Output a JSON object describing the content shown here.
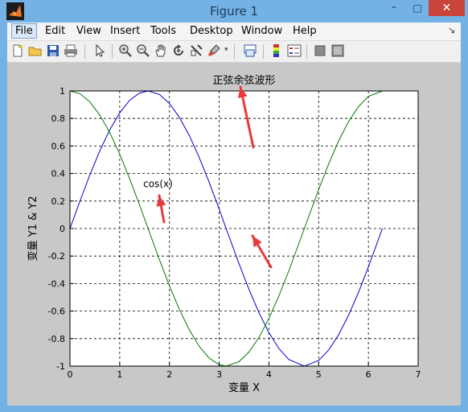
{
  "window": {
    "title": "Figure 1"
  },
  "menu": {
    "items": [
      {
        "id": "file",
        "label": "File"
      },
      {
        "id": "edit",
        "label": "Edit"
      },
      {
        "id": "view",
        "label": "View"
      },
      {
        "id": "insert",
        "label": "Insert"
      },
      {
        "id": "tools",
        "label": "Tools"
      },
      {
        "id": "desktop",
        "label": "Desktop"
      },
      {
        "id": "window",
        "label": "Window"
      },
      {
        "id": "help",
        "label": "Help"
      }
    ]
  },
  "toolbar": {
    "icons": [
      "new-figure-icon",
      "open-file-icon",
      "save-icon",
      "print-icon",
      "pointer-icon",
      "zoom-in-icon",
      "zoom-out-icon",
      "pan-icon",
      "rotate-3d-icon",
      "data-cursor-icon",
      "brush-icon",
      "link-plot-icon",
      "colorbar-icon",
      "legend-icon",
      "hide-plot-tools-icon",
      "show-plot-tools-icon"
    ]
  },
  "colors": {
    "series_sin": "#0000cc",
    "series_cos": "#007a00",
    "annotation_arrow": "#e83a3a"
  },
  "chart_data": {
    "type": "line",
    "title": "正弦余弦波形",
    "xlabel": "变量 X",
    "ylabel": "变量 Y1 & Y2",
    "xlim": [
      0,
      7
    ],
    "ylim": [
      -1,
      1
    ],
    "xticks": [
      "0",
      "1",
      "2",
      "3",
      "4",
      "5",
      "6",
      "7"
    ],
    "yticks": [
      "1",
      "0.8",
      "0.6",
      "0.4",
      "0.2",
      "0",
      "-0.2",
      "-0.4",
      "-0.6",
      "-0.8",
      "-1"
    ],
    "grid": true,
    "annotations": [
      {
        "text": "cos(x)",
        "x": 1.77,
        "y": 0.3
      }
    ],
    "series": [
      {
        "color": "#0000cc",
        "x": [
          0,
          0.2,
          0.4,
          0.6,
          0.8,
          1.0,
          1.2,
          1.4,
          1.571,
          1.8,
          2.0,
          2.2,
          2.4,
          2.6,
          2.8,
          3.0,
          3.14,
          3.4,
          3.6,
          3.8,
          4.0,
          4.2,
          4.4,
          4.712,
          5.0,
          5.2,
          5.4,
          5.6,
          5.8,
          6.0,
          6.28
        ],
        "y": [
          0,
          0.199,
          0.389,
          0.565,
          0.717,
          0.841,
          0.932,
          0.985,
          1.0,
          0.974,
          0.909,
          0.808,
          0.675,
          0.516,
          0.335,
          0.141,
          0.0,
          -0.256,
          -0.443,
          -0.612,
          -0.757,
          -0.872,
          -0.952,
          -1.0,
          -0.959,
          -0.883,
          -0.773,
          -0.631,
          -0.465,
          -0.279,
          0.0
        ]
      },
      {
        "color": "#007a00",
        "x": [
          0,
          0.2,
          0.4,
          0.6,
          0.8,
          1.0,
          1.2,
          1.4,
          1.571,
          1.8,
          2.0,
          2.2,
          2.4,
          2.6,
          2.8,
          3.0,
          3.14,
          3.4,
          3.6,
          3.8,
          4.0,
          4.2,
          4.4,
          4.712,
          5.0,
          5.2,
          5.4,
          5.6,
          5.8,
          6.0,
          6.28
        ],
        "y": [
          1.0,
          0.98,
          0.921,
          0.825,
          0.697,
          0.54,
          0.362,
          0.17,
          0.0,
          -0.227,
          -0.416,
          -0.589,
          -0.737,
          -0.857,
          -0.942,
          -0.99,
          -1.0,
          -0.967,
          -0.897,
          -0.791,
          -0.654,
          -0.49,
          -0.307,
          0.0,
          0.284,
          0.469,
          0.635,
          0.776,
          0.886,
          0.96,
          1.0
        ]
      }
    ]
  }
}
